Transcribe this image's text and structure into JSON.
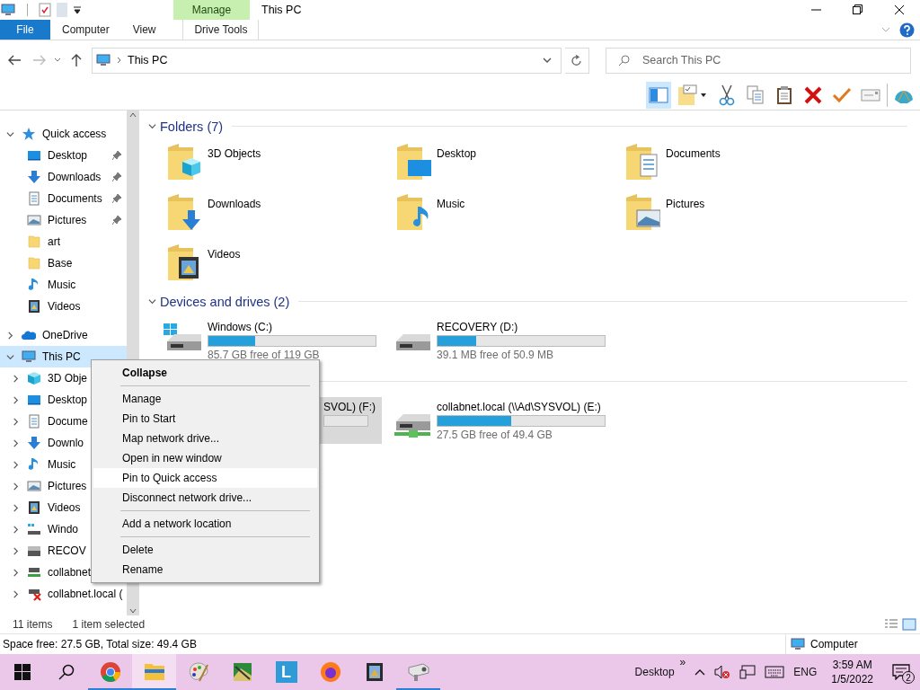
{
  "title_bar": {
    "context_tab": "Manage",
    "title": "This PC"
  },
  "ribbon_tabs": [
    {
      "label": "File",
      "kind": "file",
      "selected": false
    },
    {
      "label": "Computer",
      "kind": "plain",
      "selected": false
    },
    {
      "label": "View",
      "kind": "plain",
      "selected": false
    },
    {
      "label": "Drive Tools",
      "kind": "context",
      "selected": false
    }
  ],
  "address": {
    "path": "This PC"
  },
  "search": {
    "placeholder": "Search This PC"
  },
  "nav_tree": [
    {
      "label": "Quick access",
      "kind": "star",
      "expanded": true,
      "selected": false,
      "children": [
        {
          "label": "Desktop",
          "kind": "desktop",
          "pinned": true,
          "selected": false
        },
        {
          "label": "Downloads",
          "kind": "download",
          "pinned": true,
          "selected": false
        },
        {
          "label": "Documents",
          "kind": "document",
          "pinned": true,
          "selected": false
        },
        {
          "label": "Pictures",
          "kind": "picture",
          "pinned": true,
          "selected": false
        },
        {
          "label": "art",
          "kind": "folder",
          "pinned": false,
          "selected": false
        },
        {
          "label": "Base",
          "kind": "folder",
          "pinned": false,
          "selected": false
        },
        {
          "label": "Music",
          "kind": "music",
          "pinned": false,
          "selected": false
        },
        {
          "label": "Videos",
          "kind": "video",
          "pinned": false,
          "selected": false
        }
      ]
    },
    {
      "label": "OneDrive",
      "kind": "cloud",
      "expanded": false,
      "selected": false
    },
    {
      "label": "This PC",
      "kind": "pc",
      "expanded": true,
      "selected": true,
      "children": [
        {
          "label": "3D Obje",
          "kind": "cube",
          "expanded": false,
          "selected": false
        },
        {
          "label": "Desktop",
          "kind": "desktop",
          "expanded": false,
          "selected": false
        },
        {
          "label": "Docume",
          "kind": "document",
          "expanded": false,
          "selected": false
        },
        {
          "label": "Downlo",
          "kind": "download",
          "expanded": false,
          "selected": false
        },
        {
          "label": "Music",
          "kind": "music",
          "expanded": false,
          "selected": false
        },
        {
          "label": "Pictures",
          "kind": "picture",
          "expanded": false,
          "selected": false
        },
        {
          "label": "Videos",
          "kind": "video",
          "expanded": false,
          "selected": false
        },
        {
          "label": "Windo",
          "kind": "drive-windows",
          "expanded": false,
          "selected": false
        },
        {
          "label": "RECOV",
          "kind": "drive",
          "expanded": false,
          "selected": false
        },
        {
          "label": "collabnet",
          "kind": "network",
          "expanded": false,
          "selected": false
        },
        {
          "label": "collabnet.local (",
          "kind": "network-x",
          "expanded": false,
          "selected": false
        }
      ]
    }
  ],
  "sections": [
    {
      "title": "Folders (7)",
      "kind": "folders",
      "expanded": true,
      "items": [
        {
          "label": "3D Objects",
          "kind": "cube"
        },
        {
          "label": "Desktop",
          "kind": "desktop"
        },
        {
          "label": "Documents",
          "kind": "document"
        },
        {
          "label": "Downloads",
          "kind": "download"
        },
        {
          "label": "Music",
          "kind": "music"
        },
        {
          "label": "Pictures",
          "kind": "picture"
        },
        {
          "label": "Videos",
          "kind": "video"
        }
      ]
    },
    {
      "title": "Devices and drives (2)",
      "kind": "drives",
      "expanded": true,
      "items": [
        {
          "label": "Windows (C:)",
          "kind": "windows",
          "level": 0.28,
          "reading": "85.7 GB free of 119 GB",
          "selected": false
        },
        {
          "label": "RECOVERY (D:)",
          "kind": "drive",
          "level": 0.23,
          "reading": "39.1 MB free of 50.9 MB",
          "selected": false
        }
      ]
    },
    {
      "kind": "drives",
      "items": [
        {
          "label": "SVOL) (F:)",
          "kind": "covered",
          "selected": true
        },
        {
          "label": "collabnet.local (\\\\Ad\\SYSVOL) (E:)",
          "kind": "network",
          "level": 0.44,
          "reading": "27.5 GB free of 49.4 GB",
          "selected": false
        }
      ]
    }
  ],
  "status_bar": {
    "count": "11 items",
    "selection": "1 item selected"
  },
  "details_bar": {
    "space": "Space free: 27.5 GB, Total size: 49.4 GB",
    "location": "Computer"
  },
  "context_menu": [
    {
      "kind": "item",
      "label": "Collapse",
      "default": true,
      "selected": false
    },
    {
      "kind": "separator"
    },
    {
      "kind": "item",
      "label": "Manage",
      "default": false,
      "selected": false
    },
    {
      "kind": "item",
      "label": "Pin to Start",
      "default": false,
      "selected": false
    },
    {
      "kind": "item",
      "label": "Map network drive...",
      "default": false,
      "selected": false
    },
    {
      "kind": "item",
      "label": "Open in new window",
      "default": false,
      "selected": false
    },
    {
      "kind": "item",
      "label": "Pin to Quick access",
      "default": false,
      "selected": true
    },
    {
      "kind": "item",
      "label": "Disconnect network drive...",
      "default": false,
      "selected": false
    },
    {
      "kind": "separator"
    },
    {
      "kind": "item",
      "label": "Add a network location",
      "default": false,
      "selected": false
    },
    {
      "kind": "separator"
    },
    {
      "kind": "item",
      "label": "Delete",
      "default": false,
      "selected": false
    },
    {
      "kind": "item",
      "label": "Rename",
      "default": false,
      "selected": false
    }
  ],
  "taskbar": {
    "apps": [
      {
        "kind": "chrome",
        "running": true,
        "selected": false
      },
      {
        "kind": "explorer",
        "running": true,
        "selected": true
      },
      {
        "kind": "paint",
        "running": false,
        "selected": false
      },
      {
        "kind": "photo",
        "running": false,
        "selected": false
      },
      {
        "kind": "letter",
        "label": "L",
        "running": false,
        "selected": false
      },
      {
        "kind": "firefox",
        "running": false,
        "selected": false
      },
      {
        "kind": "film",
        "running": false,
        "selected": false
      },
      {
        "kind": "camera",
        "running": true,
        "selected": false
      }
    ],
    "toolbar_label": "Desktop",
    "overflow": "»",
    "language": "ENG",
    "time": "3:59 AM",
    "date": "1/5/2022",
    "notifications": "2"
  }
}
